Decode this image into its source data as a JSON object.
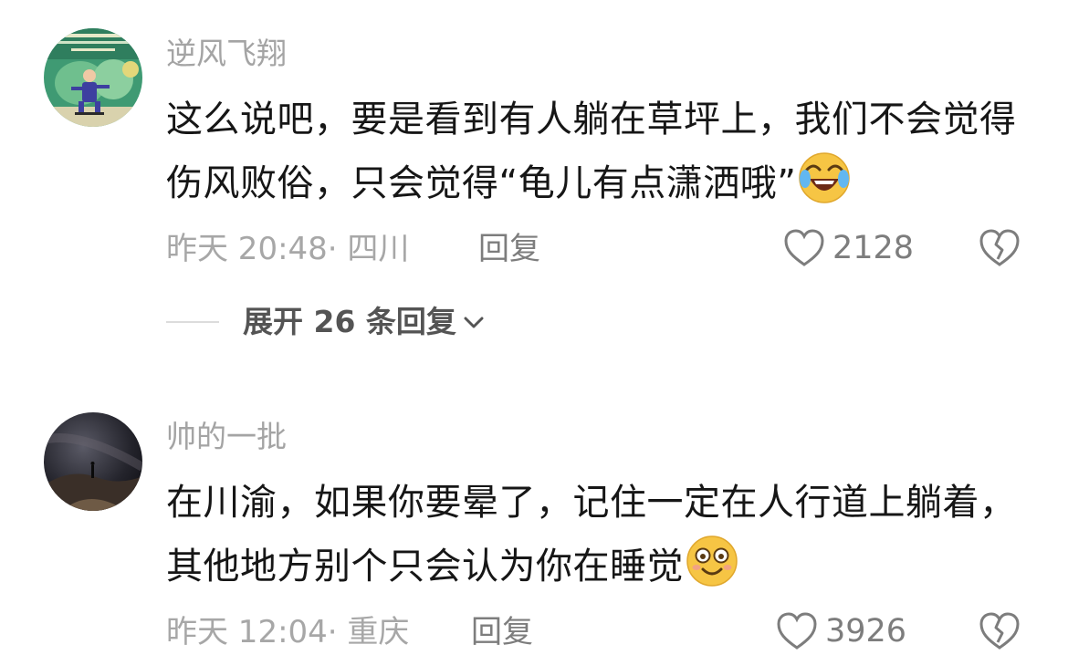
{
  "comments": [
    {
      "username": "逆风飞翔",
      "text": "这么说吧，要是看到有人躺在草坪上，我们不会觉得伤风败俗，只会觉得“龟儿有点潇洒哦”",
      "emoji": "laughing-crying-emoji",
      "time": "昨天 20:48",
      "separator": "·",
      "location": "四川",
      "reply_label": "回复",
      "likes": "2128",
      "expand_label": "展开 26 条回复"
    },
    {
      "username": "帅的一批",
      "text": "在川渝，如果你要晕了，记住一定在人行道上躺着，其他地方别个只会认为你在睡觉",
      "emoji": "smiling-face-emoji",
      "time": "昨天 12:04",
      "separator": "·",
      "location": "重庆",
      "reply_label": "回复",
      "likes": "3926"
    }
  ],
  "colors": {
    "username": "#a4a4a4",
    "text": "#161616",
    "meta": "#a7a7a7",
    "action": "#7d7d7d"
  }
}
